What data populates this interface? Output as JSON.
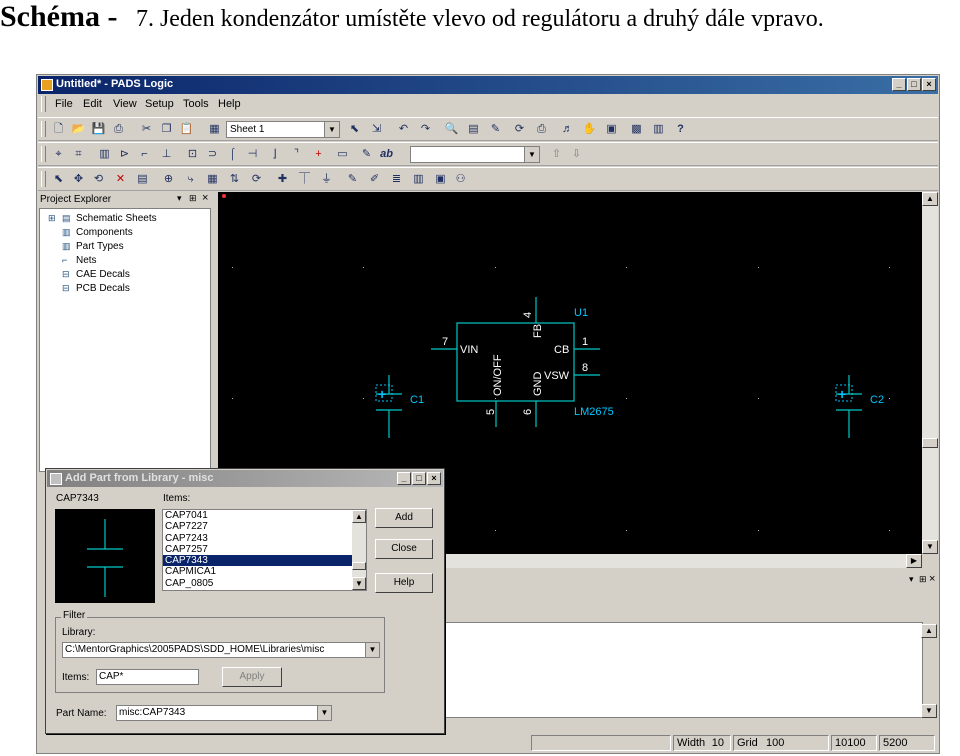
{
  "slide": {
    "title_bold": "Schéma -",
    "title_text": "7. Jeden kondenzátor umístěte vlevo od regulátoru a druhý dále vpravo."
  },
  "window": {
    "title": "Untitled* - PADS Logic",
    "menus": [
      "File",
      "Edit",
      "View",
      "Setup",
      "Tools",
      "Help"
    ],
    "sheet_combo": "Sheet 1",
    "text_style_label": "ab",
    "layout_combo": ""
  },
  "explorer": {
    "title": "Project Explorer",
    "items": [
      "Schematic Sheets",
      "Components",
      "Part Types",
      "Nets",
      "CAE Decals",
      "PCB Decals"
    ]
  },
  "schematic": {
    "regulator_ref": "U1",
    "regulator_value": "LM2675",
    "pins": [
      {
        "num": "4",
        "name": "FB"
      },
      {
        "num": "7",
        "name": "VIN"
      },
      {
        "num": "1",
        "name": "CB"
      },
      {
        "num": "8",
        "name": "VSW"
      },
      {
        "num": "5",
        "name": "ON/OFF"
      },
      {
        "num": "6",
        "name": "GND"
      }
    ],
    "cap_left_ref": "C1",
    "cap_right_ref": "C2",
    "plus": "+"
  },
  "dialog": {
    "title": "Add Part from Library - misc",
    "preview_label": "CAP7343",
    "items_label": "Items:",
    "items": [
      "CAP7041",
      "CAP7227",
      "CAP7243",
      "CAP7257",
      "CAP7343",
      "CAPMICA1",
      "CAP_0805"
    ],
    "selected_item": "CAP7343",
    "buttons": {
      "add": "Add",
      "close": "Close",
      "help": "Help",
      "apply": "Apply"
    },
    "filter_label": "Filter",
    "library_label": "Library:",
    "library_value": "C:\\MentorGraphics\\2005PADS\\SDD_HOME\\Libraries\\misc",
    "items_filter_label": "Items:",
    "items_filter_value": "CAP*",
    "part_name_label": "Part Name:",
    "part_name_value": "misc:CAP7343"
  },
  "statusbar": {
    "width_label": "Width",
    "width_value": "10",
    "grid_label": "Grid",
    "grid_value": "100",
    "x_value": "10100",
    "y_value": "5200"
  },
  "colors": {
    "schematic_line": "#00c8c8",
    "part_label": "#00c8ff",
    "pin_label": "#ffffff",
    "selection_highlight": "#0a246a"
  }
}
